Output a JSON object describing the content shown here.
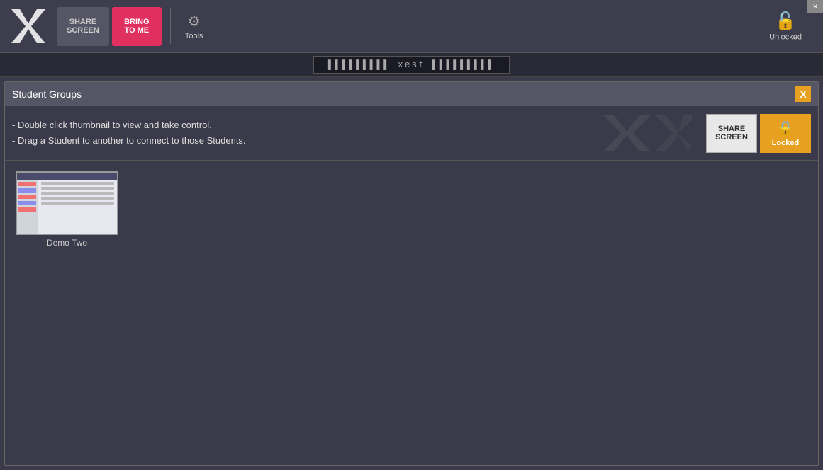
{
  "titlebar": {
    "logo_alt": "Xest Logo",
    "share_screen_label": "SHARE\nSCREEN",
    "share_screen_line1": "SHARE",
    "share_screen_line2": "SCREEN",
    "bring_to_me_line1": "BRING",
    "bring_to_me_line2": "TO ME",
    "tools_label": "Tools",
    "unlocked_label": "Unlocked",
    "close_label": "×"
  },
  "xest_bar": {
    "label": "▌▌▌▌▌▌▌▌▌ xest ▌▌▌▌▌▌▌▌▌"
  },
  "panel": {
    "title": "Student Groups",
    "close_label": "X",
    "instruction1": "- Double click thumbnail to view and take control.",
    "instruction2": "- Drag a Student to another to connect to those Students.",
    "share_screen_line1": "SHARE",
    "share_screen_line2": "SCREEN",
    "locked_label": "Locked"
  },
  "students": [
    {
      "name": "Demo Two"
    }
  ],
  "colors": {
    "bring_to_me": "#e03060",
    "locked_btn": "#e8a020",
    "panel_close": "#e8a020"
  }
}
